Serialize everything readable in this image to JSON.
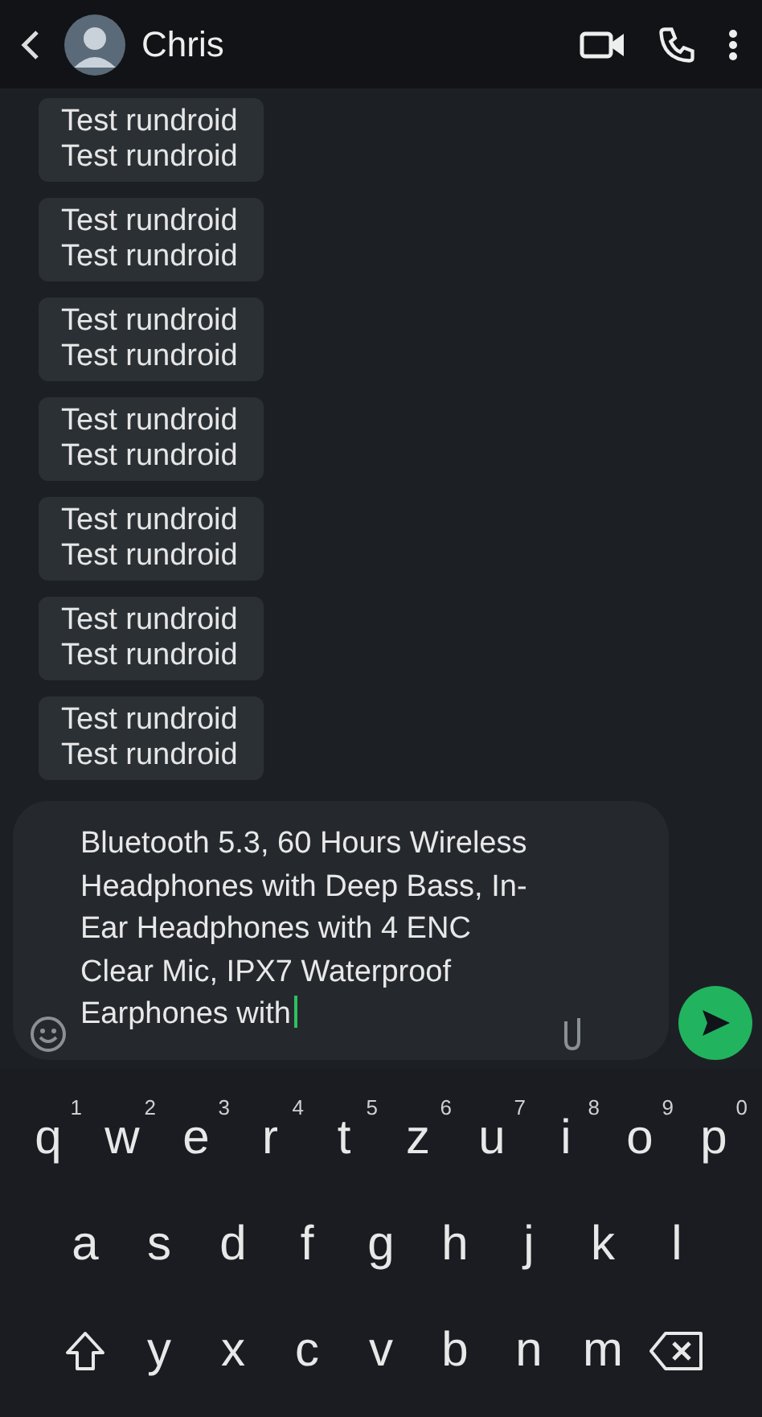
{
  "header": {
    "title": "Chris"
  },
  "messages": [
    {
      "lines": [
        "Test rundroid",
        "Test rundroid"
      ]
    },
    {
      "lines": [
        "Test rundroid",
        "Test rundroid"
      ]
    },
    {
      "lines": [
        "Test rundroid",
        "Test rundroid"
      ]
    },
    {
      "lines": [
        "Test rundroid",
        "Test rundroid"
      ]
    },
    {
      "lines": [
        "Test rundroid",
        "Test rundroid"
      ]
    },
    {
      "lines": [
        "Test rundroid",
        "Test rundroid"
      ]
    },
    {
      "lines": [
        "Test rundroid",
        "Test rundroid"
      ]
    }
  ],
  "composer": {
    "value": "Bluetooth 5.3, 60 Hours Wireless Headphones with Deep Bass, In-Ear Headphones with 4 ENC Clear Mic, IPX7 Waterproof Earphones with"
  },
  "keyboard": {
    "rows": [
      [
        {
          "kind": "letter",
          "key": "q",
          "hint": "1"
        },
        {
          "kind": "letter",
          "key": "w",
          "hint": "2"
        },
        {
          "kind": "letter",
          "key": "e",
          "hint": "3"
        },
        {
          "kind": "letter",
          "key": "r",
          "hint": "4"
        },
        {
          "kind": "letter",
          "key": "t",
          "hint": "5"
        },
        {
          "kind": "letter",
          "key": "z",
          "hint": "6"
        },
        {
          "kind": "letter",
          "key": "u",
          "hint": "7"
        },
        {
          "kind": "letter",
          "key": "i",
          "hint": "8"
        },
        {
          "kind": "letter",
          "key": "o",
          "hint": "9"
        },
        {
          "kind": "letter",
          "key": "p",
          "hint": "0"
        }
      ],
      [
        {
          "kind": "letter",
          "key": "a"
        },
        {
          "kind": "letter",
          "key": "s"
        },
        {
          "kind": "letter",
          "key": "d"
        },
        {
          "kind": "letter",
          "key": "f"
        },
        {
          "kind": "letter",
          "key": "g"
        },
        {
          "kind": "letter",
          "key": "h"
        },
        {
          "kind": "letter",
          "key": "j"
        },
        {
          "kind": "letter",
          "key": "k"
        },
        {
          "kind": "letter",
          "key": "l"
        }
      ],
      [
        {
          "kind": "shift"
        },
        {
          "kind": "letter",
          "key": "y"
        },
        {
          "kind": "letter",
          "key": "x"
        },
        {
          "kind": "letter",
          "key": "c"
        },
        {
          "kind": "letter",
          "key": "v"
        },
        {
          "kind": "letter",
          "key": "b"
        },
        {
          "kind": "letter",
          "key": "n"
        },
        {
          "kind": "letter",
          "key": "m"
        },
        {
          "kind": "backspace"
        }
      ]
    ]
  }
}
